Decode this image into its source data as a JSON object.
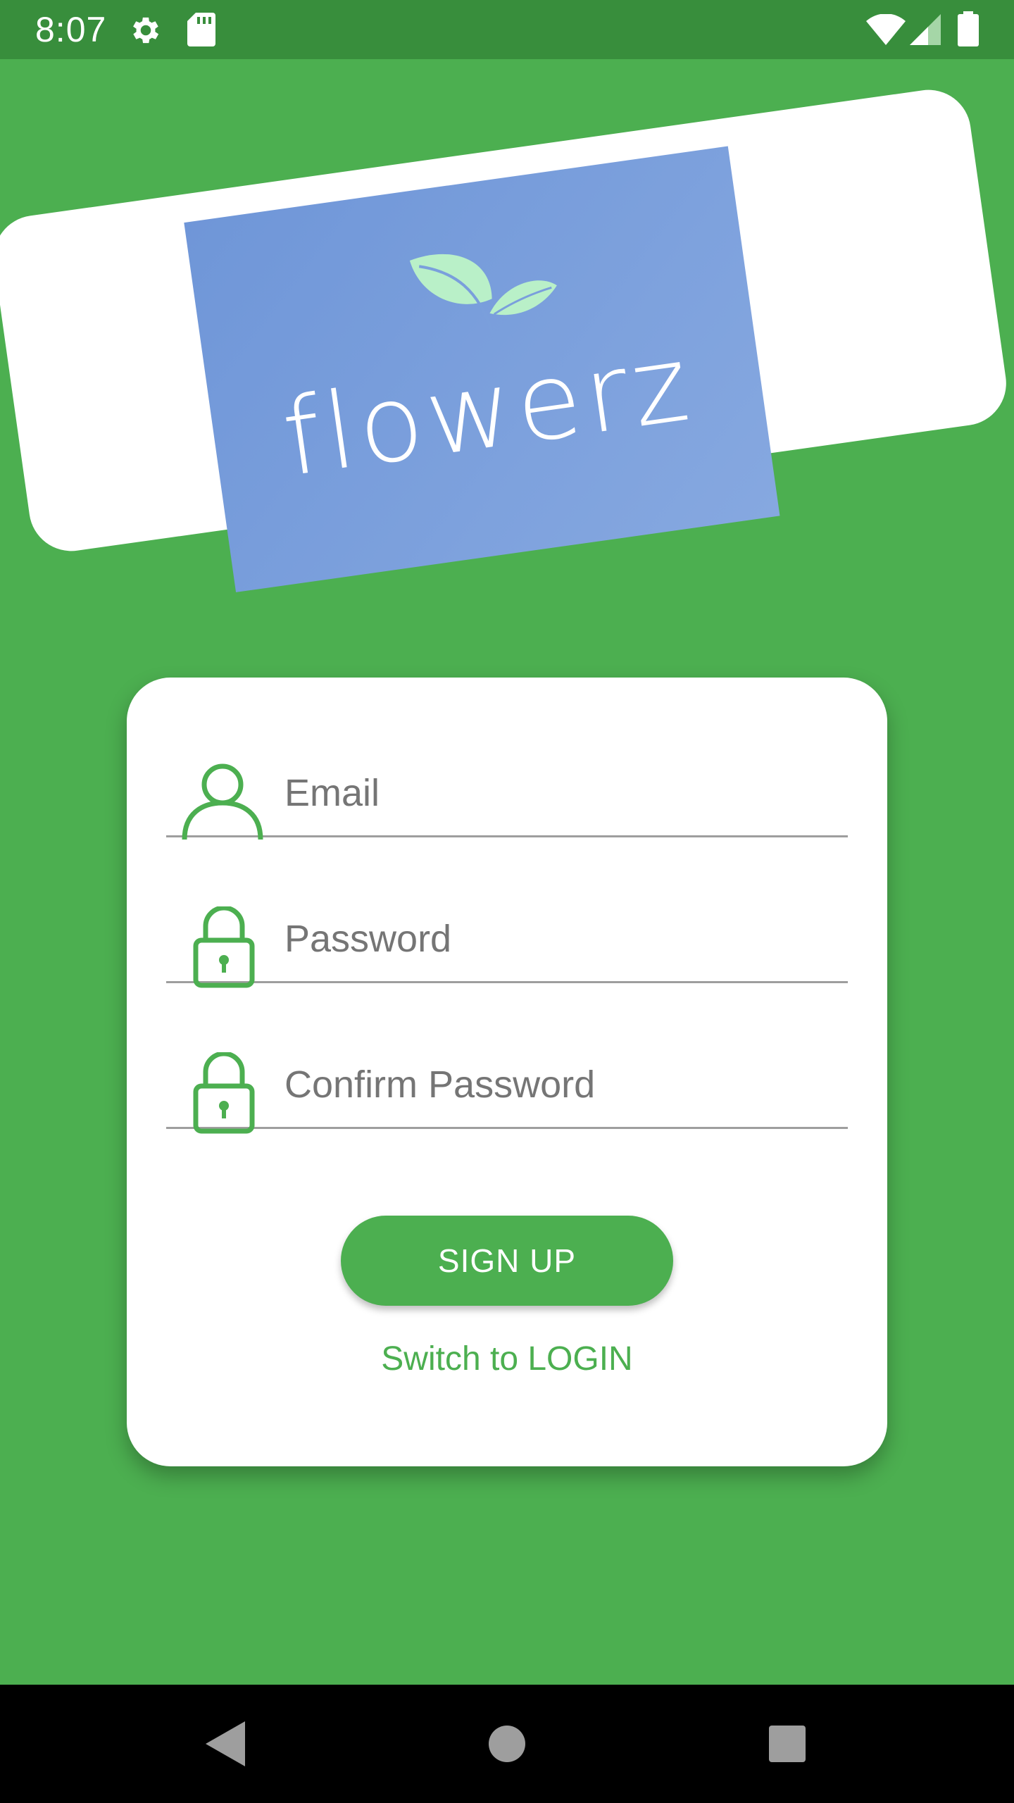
{
  "status_bar": {
    "time": "8:07",
    "icons": [
      "settings-icon",
      "sd-card-icon",
      "wifi-icon",
      "signal-icon",
      "battery-icon"
    ]
  },
  "logo": {
    "text": "flowerz",
    "icon": "leaf-icon"
  },
  "form": {
    "email_placeholder": "Email",
    "password_placeholder": "Password",
    "confirm_password_placeholder": "Confirm Password",
    "signup_label": "SIGN UP",
    "switch_label": "Switch to LOGIN"
  },
  "nav_bar": {
    "icons": [
      "back-icon",
      "home-icon",
      "recents-icon"
    ]
  },
  "colors": {
    "background": "#4caf50",
    "status_bar": "#388e3c",
    "accent": "#4caf50",
    "logo_box": "#7a9fdc",
    "leaf": "#b9f0c8"
  }
}
